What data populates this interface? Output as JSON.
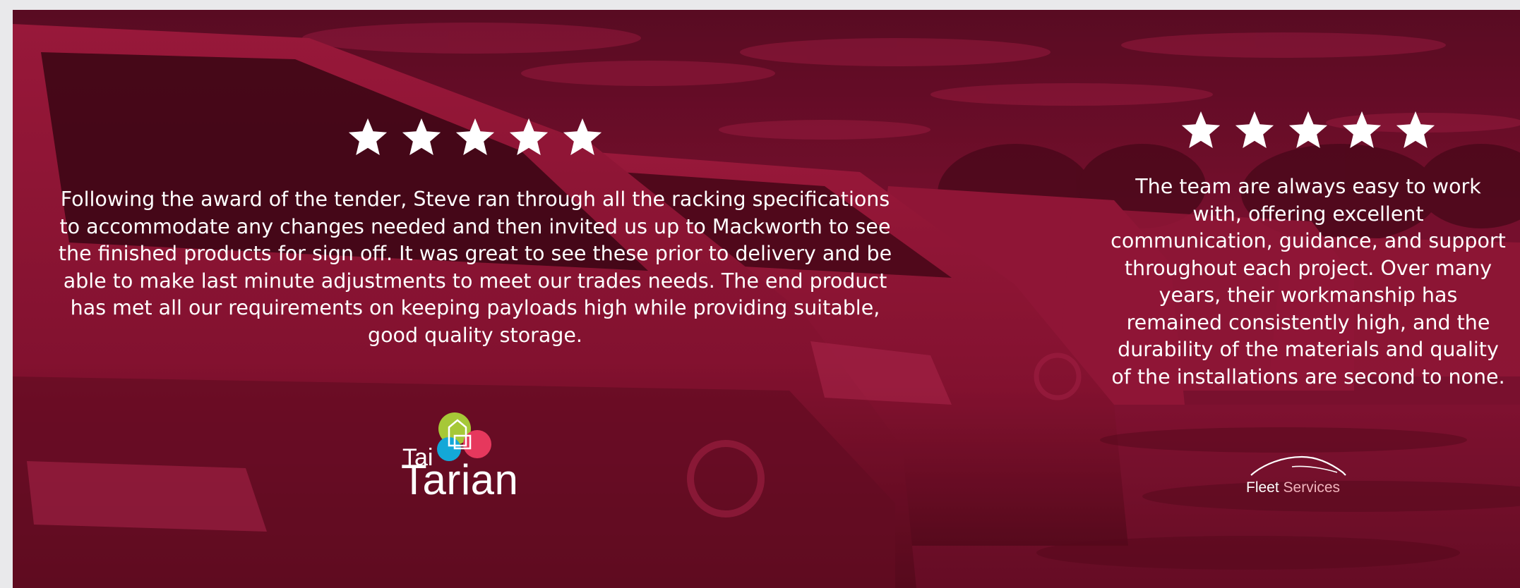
{
  "banner": {
    "overlay_color": "#8e0f32",
    "text_color": "#ffffff"
  },
  "reviews": [
    {
      "rating": 5,
      "rating_max": 5,
      "star_icon": "star-icon",
      "quote": "Following the award of the tender, Steve ran through all the racking specifications to accommodate any changes needed and then invited us up to Mackworth to see the finished products for sign off. It was great to see these prior to delivery and be able to make last minute adjustments to meet our trades needs. The end product has met all our requirements on keeping payloads high while providing suitable, good quality storage.",
      "logo": {
        "line1": "Tai",
        "line2": "Tarian",
        "colors": [
          "#a6c837",
          "#13a8d8",
          "#e6385d"
        ]
      }
    },
    {
      "rating": 5,
      "rating_max": 5,
      "star_icon": "star-icon",
      "quote": "The team are always easy to work with, offering excellent communication, guidance, and support throughout each project. Over many years, their workmanship has remained consistently high, and the durability of the materials and quality of the installations are second to none.",
      "logo": {
        "word1": "Fleet",
        "word2": "Services",
        "accent_color": "#f1b4bd"
      }
    }
  ]
}
